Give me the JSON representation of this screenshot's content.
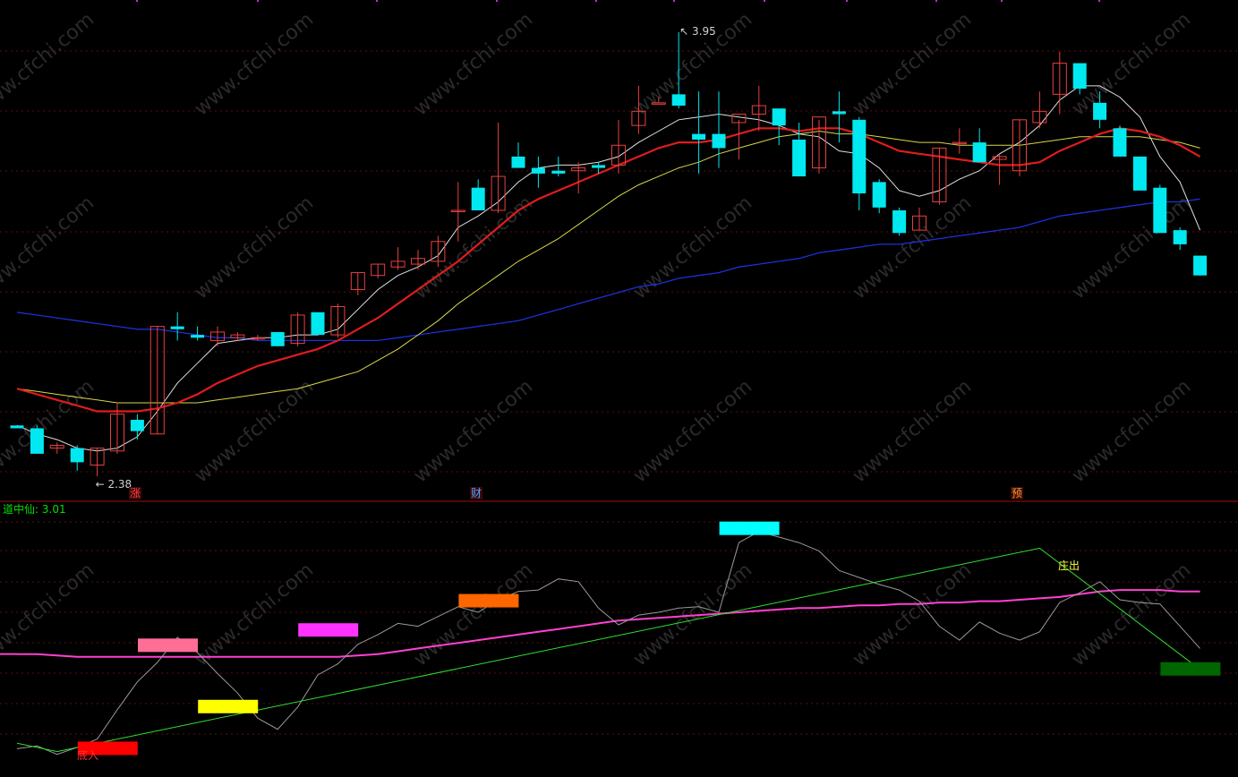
{
  "chart_data": [
    {
      "type": "candlestick",
      "title": "",
      "high_marker": "3.95",
      "low_marker": "2.38",
      "event_tags": [
        {
          "label": "涨",
          "color": "#ff4040"
        },
        {
          "label": "财",
          "color": "#4fa3ff"
        },
        {
          "label": "预",
          "color": "#ff9a2e"
        }
      ],
      "candles": [
        {
          "o": 2.56,
          "h": 2.56,
          "l": 2.55,
          "c": 2.55
        },
        {
          "o": 2.55,
          "h": 2.56,
          "l": 2.46,
          "c": 2.46
        },
        {
          "o": 2.48,
          "h": 2.5,
          "l": 2.46,
          "c": 2.49
        },
        {
          "o": 2.48,
          "h": 2.49,
          "l": 2.4,
          "c": 2.43
        },
        {
          "o": 2.42,
          "h": 2.48,
          "l": 2.38,
          "c": 2.48
        },
        {
          "o": 2.47,
          "h": 2.64,
          "l": 2.46,
          "c": 2.6
        },
        {
          "o": 2.58,
          "h": 2.6,
          "l": 2.51,
          "c": 2.54
        },
        {
          "o": 2.53,
          "h": 2.91,
          "l": 2.53,
          "c": 2.91
        },
        {
          "o": 2.91,
          "h": 2.96,
          "l": 2.86,
          "c": 2.9
        },
        {
          "o": 2.88,
          "h": 2.91,
          "l": 2.86,
          "c": 2.87
        },
        {
          "o": 2.86,
          "h": 2.91,
          "l": 2.84,
          "c": 2.89
        },
        {
          "o": 2.87,
          "h": 2.89,
          "l": 2.86,
          "c": 2.88
        },
        {
          "o": 2.87,
          "h": 2.88,
          "l": 2.86,
          "c": 2.87
        },
        {
          "o": 2.89,
          "h": 2.89,
          "l": 2.84,
          "c": 2.84
        },
        {
          "o": 2.85,
          "h": 2.96,
          "l": 2.84,
          "c": 2.95
        },
        {
          "o": 2.96,
          "h": 2.96,
          "l": 2.88,
          "c": 2.88
        },
        {
          "o": 2.88,
          "h": 2.99,
          "l": 2.87,
          "c": 2.98
        },
        {
          "o": 3.04,
          "h": 3.1,
          "l": 3.02,
          "c": 3.1
        },
        {
          "o": 3.09,
          "h": 3.13,
          "l": 3.08,
          "c": 3.13
        },
        {
          "o": 3.12,
          "h": 3.19,
          "l": 3.11,
          "c": 3.14
        },
        {
          "o": 3.13,
          "h": 3.18,
          "l": 3.11,
          "c": 3.15
        },
        {
          "o": 3.14,
          "h": 3.23,
          "l": 3.12,
          "c": 3.21
        },
        {
          "o": 3.32,
          "h": 3.42,
          "l": 3.21,
          "c": 3.32
        },
        {
          "o": 3.4,
          "h": 3.43,
          "l": 3.32,
          "c": 3.32
        },
        {
          "o": 3.32,
          "h": 3.63,
          "l": 3.31,
          "c": 3.44
        },
        {
          "o": 3.51,
          "h": 3.56,
          "l": 3.47,
          "c": 3.47
        },
        {
          "o": 3.47,
          "h": 3.51,
          "l": 3.4,
          "c": 3.45
        },
        {
          "o": 3.46,
          "h": 3.51,
          "l": 3.44,
          "c": 3.45
        },
        {
          "o": 3.46,
          "h": 3.49,
          "l": 3.38,
          "c": 3.47
        },
        {
          "o": 3.48,
          "h": 3.49,
          "l": 3.45,
          "c": 3.47
        },
        {
          "o": 3.48,
          "h": 3.64,
          "l": 3.45,
          "c": 3.55
        },
        {
          "o": 3.62,
          "h": 3.76,
          "l": 3.59,
          "c": 3.67
        },
        {
          "o": 3.7,
          "h": 3.72,
          "l": 3.7,
          "c": 3.7
        },
        {
          "o": 3.73,
          "h": 3.95,
          "l": 3.68,
          "c": 3.69
        },
        {
          "o": 3.59,
          "h": 3.74,
          "l": 3.45,
          "c": 3.57
        },
        {
          "o": 3.59,
          "h": 3.74,
          "l": 3.47,
          "c": 3.54
        },
        {
          "o": 3.63,
          "h": 3.64,
          "l": 3.5,
          "c": 3.66
        },
        {
          "o": 3.66,
          "h": 3.76,
          "l": 3.6,
          "c": 3.69
        },
        {
          "o": 3.68,
          "h": 3.68,
          "l": 3.55,
          "c": 3.62
        },
        {
          "o": 3.57,
          "h": 3.63,
          "l": 3.44,
          "c": 3.44
        },
        {
          "o": 3.47,
          "h": 3.64,
          "l": 3.45,
          "c": 3.65
        },
        {
          "o": 3.67,
          "h": 3.74,
          "l": 3.56,
          "c": 3.66
        },
        {
          "o": 3.64,
          "h": 3.65,
          "l": 3.32,
          "c": 3.38
        },
        {
          "o": 3.42,
          "h": 3.43,
          "l": 3.31,
          "c": 3.33
        },
        {
          "o": 3.32,
          "h": 3.33,
          "l": 3.23,
          "c": 3.24
        },
        {
          "o": 3.25,
          "h": 3.33,
          "l": 3.25,
          "c": 3.3
        },
        {
          "o": 3.35,
          "h": 3.54,
          "l": 3.34,
          "c": 3.54
        },
        {
          "o": 3.56,
          "h": 3.61,
          "l": 3.52,
          "c": 3.56
        },
        {
          "o": 3.56,
          "h": 3.61,
          "l": 3.49,
          "c": 3.49
        },
        {
          "o": 3.5,
          "h": 3.52,
          "l": 3.41,
          "c": 3.51
        },
        {
          "o": 3.46,
          "h": 3.64,
          "l": 3.44,
          "c": 3.64
        },
        {
          "o": 3.63,
          "h": 3.74,
          "l": 3.61,
          "c": 3.67
        },
        {
          "o": 3.73,
          "h": 3.88,
          "l": 3.66,
          "c": 3.84
        },
        {
          "o": 3.84,
          "h": 3.84,
          "l": 3.73,
          "c": 3.75
        },
        {
          "o": 3.7,
          "h": 3.74,
          "l": 3.61,
          "c": 3.64
        },
        {
          "o": 3.61,
          "h": 3.62,
          "l": 3.51,
          "c": 3.51
        },
        {
          "o": 3.51,
          "h": 3.51,
          "l": 3.39,
          "c": 3.39
        },
        {
          "o": 3.4,
          "h": 3.41,
          "l": 3.24,
          "c": 3.24
        },
        {
          "o": 3.25,
          "h": 3.26,
          "l": 3.18,
          "c": 3.2
        },
        {
          "o": 3.16,
          "h": 3.16,
          "l": 3.09,
          "c": 3.09
        }
      ],
      "ma_white": [
        2.56,
        2.53,
        2.51,
        2.48,
        2.47,
        2.48,
        2.52,
        2.61,
        2.71,
        2.78,
        2.85,
        2.86,
        2.87,
        2.87,
        2.88,
        2.88,
        2.9,
        2.97,
        3.04,
        3.09,
        3.12,
        3.16,
        3.26,
        3.3,
        3.35,
        3.42,
        3.47,
        3.48,
        3.48,
        3.49,
        3.51,
        3.56,
        3.6,
        3.64,
        3.65,
        3.66,
        3.65,
        3.64,
        3.62,
        3.59,
        3.58,
        3.53,
        3.52,
        3.47,
        3.39,
        3.37,
        3.39,
        3.43,
        3.46,
        3.52,
        3.56,
        3.62,
        3.71,
        3.76,
        3.76,
        3.72,
        3.65,
        3.51,
        3.42,
        3.25
      ],
      "ma_red": [
        2.69,
        2.67,
        2.65,
        2.63,
        2.61,
        2.61,
        2.61,
        2.62,
        2.64,
        2.67,
        2.71,
        2.74,
        2.77,
        2.79,
        2.81,
        2.83,
        2.86,
        2.9,
        2.94,
        2.99,
        3.04,
        3.09,
        3.14,
        3.2,
        3.26,
        3.32,
        3.36,
        3.39,
        3.42,
        3.45,
        3.48,
        3.51,
        3.54,
        3.56,
        3.56,
        3.57,
        3.59,
        3.61,
        3.61,
        3.6,
        3.61,
        3.61,
        3.59,
        3.56,
        3.53,
        3.52,
        3.51,
        3.5,
        3.49,
        3.48,
        3.48,
        3.49,
        3.53,
        3.56,
        3.59,
        3.61,
        3.6,
        3.58,
        3.55,
        3.51
      ],
      "ma_yellow": [
        2.69,
        2.68,
        2.67,
        2.66,
        2.65,
        2.64,
        2.64,
        2.64,
        2.64,
        2.64,
        2.65,
        2.66,
        2.67,
        2.68,
        2.69,
        2.71,
        2.73,
        2.75,
        2.79,
        2.83,
        2.88,
        2.93,
        2.99,
        3.04,
        3.09,
        3.14,
        3.18,
        3.22,
        3.27,
        3.32,
        3.37,
        3.41,
        3.44,
        3.47,
        3.49,
        3.52,
        3.54,
        3.56,
        3.58,
        3.59,
        3.6,
        3.59,
        3.59,
        3.58,
        3.57,
        3.56,
        3.56,
        3.55,
        3.55,
        3.55,
        3.55,
        3.56,
        3.57,
        3.58,
        3.58,
        3.58,
        3.58,
        3.57,
        3.56,
        3.54
      ],
      "ma_blue": [
        2.96,
        2.95,
        2.94,
        2.93,
        2.92,
        2.91,
        2.9,
        2.9,
        2.89,
        2.88,
        2.87,
        2.87,
        2.86,
        2.86,
        2.86,
        2.86,
        2.86,
        2.86,
        2.86,
        2.87,
        2.88,
        2.89,
        2.9,
        2.91,
        2.92,
        2.93,
        2.95,
        2.97,
        2.99,
        3.01,
        3.03,
        3.05,
        3.06,
        3.08,
        3.09,
        3.1,
        3.12,
        3.13,
        3.14,
        3.15,
        3.17,
        3.18,
        3.19,
        3.2,
        3.2,
        3.21,
        3.22,
        3.23,
        3.24,
        3.25,
        3.26,
        3.28,
        3.3,
        3.31,
        3.32,
        3.33,
        3.34,
        3.35,
        3.35,
        3.36
      ],
      "ylim": [
        2.33,
        4.0
      ]
    },
    {
      "type": "line",
      "indicator_name": "道中仙",
      "indicator_value": "3.01",
      "label_bottom": "底入",
      "label_top": "庄出",
      "gray_x": [
        0,
        1,
        2,
        3,
        4,
        5,
        6,
        7,
        8,
        9,
        10,
        11,
        12,
        13,
        14,
        15,
        16,
        17,
        18,
        19,
        20,
        21,
        22,
        23,
        24,
        25,
        26,
        27,
        28,
        29,
        30,
        31,
        32,
        33,
        34,
        35,
        36,
        37,
        38,
        39,
        40,
        41,
        42,
        43,
        44,
        45,
        46,
        47,
        48,
        49,
        50,
        51,
        52,
        53,
        54,
        55,
        56,
        57,
        58,
        59
      ],
      "gray_values": [
        10,
        12,
        6,
        11,
        17,
        38,
        58,
        72,
        90,
        79,
        64,
        50,
        32,
        24,
        40,
        63,
        71,
        85,
        92,
        100,
        98,
        105,
        112,
        108,
        117,
        123,
        124,
        132,
        130,
        111,
        99,
        106,
        108,
        111,
        112,
        108,
        158,
        166,
        162,
        158,
        152,
        138,
        133,
        128,
        124,
        116,
        98,
        88,
        101,
        93,
        88,
        94,
        115,
        122,
        130,
        117,
        115,
        114,
        98,
        82
      ],
      "magenta_values": [
        78,
        78,
        77,
        76,
        76,
        76,
        76,
        76,
        76,
        76,
        76,
        76,
        76,
        76,
        76,
        76,
        76,
        77,
        78,
        80,
        82,
        84,
        86,
        88,
        90,
        92,
        94,
        96,
        98,
        100,
        102,
        103,
        104,
        105,
        106,
        107,
        108,
        109,
        110,
        111,
        111,
        112,
        113,
        113,
        114,
        114,
        115,
        115,
        116,
        116,
        117,
        118,
        119,
        121,
        123,
        124,
        124,
        124,
        123,
        123
      ],
      "green_trend": {
        "x": [
          0,
          2,
          51,
          59
        ],
        "y": [
          14,
          8,
          154,
          67
        ]
      },
      "markers": [
        {
          "x": 4.5,
          "y": 10,
          "color": "#ff0000"
        },
        {
          "x": 7.5,
          "y": 84,
          "color": "#ff6e96"
        },
        {
          "x": 10.5,
          "y": 40,
          "color": "#ffff00"
        },
        {
          "x": 15.5,
          "y": 95,
          "color": "#ff32ff"
        },
        {
          "x": 23.5,
          "y": 116,
          "color": "#ff6600"
        },
        {
          "x": 36.5,
          "y": 168,
          "color": "#00ffff"
        },
        {
          "x": 58.5,
          "y": 67,
          "color": "#006600"
        }
      ],
      "ylim": [
        0,
        180
      ]
    }
  ]
}
